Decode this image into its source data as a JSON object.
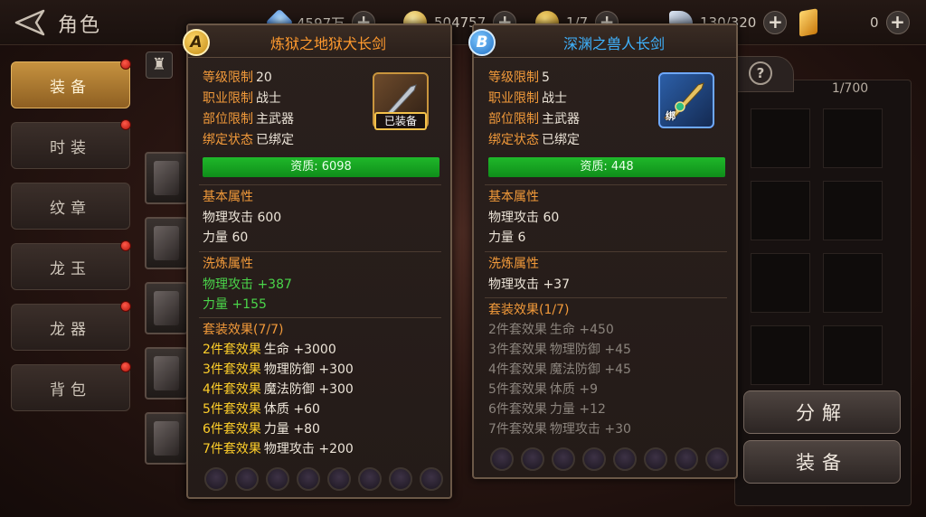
{
  "header": {
    "title": "角色",
    "resources": [
      {
        "name": "diamond",
        "icon": "gem-icon",
        "value": "4597万",
        "color": "#4aa3ff"
      },
      {
        "name": "gold",
        "icon": "coin-icon",
        "value": "504757",
        "color": "#e0b23a"
      },
      {
        "name": "token",
        "icon": "token-icon",
        "value": "1/7",
        "color": "#d6a53a"
      },
      {
        "name": "stamina",
        "icon": "stamina-icon",
        "value": "130/320",
        "color": "#9fb0c8"
      },
      {
        "name": "crystal",
        "icon": "crystal-icon",
        "value": "0",
        "color": "#f0b23a"
      }
    ]
  },
  "sidebar": {
    "tabs": [
      {
        "label": "装备",
        "active": true,
        "dot": true
      },
      {
        "label": "时装",
        "active": false,
        "dot": true
      },
      {
        "label": "纹章",
        "active": false,
        "dot": false
      },
      {
        "label": "龙玉",
        "active": false,
        "dot": true
      },
      {
        "label": "龙器",
        "active": false,
        "dot": true
      },
      {
        "label": "背包",
        "active": false,
        "dot": true
      }
    ]
  },
  "bag": {
    "count": "1/700",
    "decompose_label": "分解",
    "equip_label": "装备"
  },
  "tooltip_a": {
    "badge": "A",
    "title": "炼狱之地狱犬长剑",
    "level_key": "等级限制",
    "level_val": "20",
    "job_key": "职业限制",
    "job_val": "战士",
    "slot_key": "部位限制",
    "slot_val": "主武器",
    "bind_key": "绑定状态",
    "bind_val": "已绑定",
    "equipped_tag": "已装备",
    "grade": "资质: 6098",
    "base_title": "基本属性",
    "base_stats": [
      "物理攻击 600",
      "力量 60"
    ],
    "refine_title": "洗炼属性",
    "refine_stats": [
      "物理攻击 +387",
      "力量 +155"
    ],
    "set_title": "套装效果(7/7)",
    "set_effects": [
      {
        "k": "2件套效果",
        "v": "生命 +3000"
      },
      {
        "k": "3件套效果",
        "v": "物理防御 +300"
      },
      {
        "k": "4件套效果",
        "v": "魔法防御 +300"
      },
      {
        "k": "5件套效果",
        "v": "体质 +60"
      },
      {
        "k": "6件套效果",
        "v": "力量 +80"
      },
      {
        "k": "7件套效果",
        "v": "物理攻击 +200"
      }
    ],
    "gem_slots": 8
  },
  "tooltip_b": {
    "badge": "B",
    "title": "深渊之兽人长剑",
    "level_key": "等级限制",
    "level_val": "5",
    "job_key": "职业限制",
    "job_val": "战士",
    "slot_key": "部位限制",
    "slot_val": "主武器",
    "bind_key": "绑定状态",
    "bind_val": "已绑定",
    "bind_tag": "绑",
    "grade": "资质: 448",
    "base_title": "基本属性",
    "base_stats": [
      "物理攻击 60",
      "力量 6"
    ],
    "refine_title": "洗炼属性",
    "refine_stats": [
      "物理攻击 +37"
    ],
    "set_title": "套装效果(1/7)",
    "set_effects": [
      {
        "k": "2件套效果",
        "v": "生命 +450"
      },
      {
        "k": "3件套效果",
        "v": "物理防御 +45"
      },
      {
        "k": "4件套效果",
        "v": "魔法防御 +45"
      },
      {
        "k": "5件套效果",
        "v": "体质 +9"
      },
      {
        "k": "6件套效果",
        "v": "力量 +12"
      },
      {
        "k": "7件套效果",
        "v": "物理攻击 +30"
      }
    ],
    "gem_slots": 8
  }
}
